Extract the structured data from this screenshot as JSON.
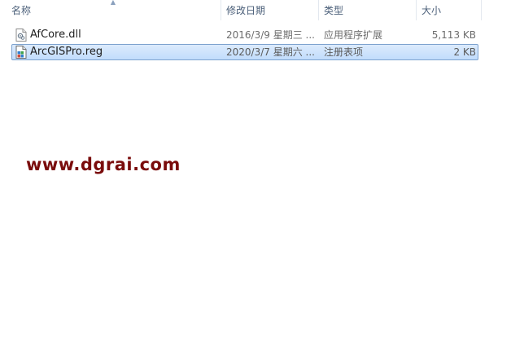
{
  "columns": {
    "name": "名称",
    "date": "修改日期",
    "type": "类型",
    "size": "大小"
  },
  "files": [
    {
      "name": "AfCore.dll",
      "date": "2016/3/9 星期三 ...",
      "type": "应用程序扩展",
      "size": "5,113 KB",
      "icon": "dll-file-icon",
      "selected": false
    },
    {
      "name": "ArcGISPro.reg",
      "date": "2020/3/7 星期六 ...",
      "type": "注册表项",
      "size": "2 KB",
      "icon": "registry-file-icon",
      "selected": true
    }
  ],
  "watermark": "www.dgrai.com",
  "colors": {
    "header_text": "#4c607a",
    "selection_border": "#7da2ce",
    "selection_fill": "#c1dcfc",
    "watermark": "#7a0c0c"
  }
}
